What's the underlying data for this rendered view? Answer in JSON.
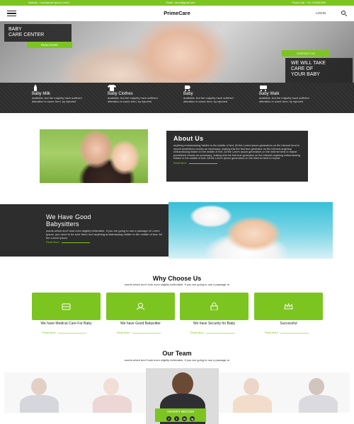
{
  "topbar": {
    "address": "Address : Loremipsum Ipsum Lorem",
    "email": "Email : demo@gmail.com",
    "phone": "Phone Call : +91 1234567890"
  },
  "nav": {
    "brand": "PrimeCare",
    "login": "LOGIN"
  },
  "hero": {
    "title_line1": "BABY",
    "title_line2": "CARE CENTER",
    "read_more": "READ MORE",
    "contact_us": "CONTACT US",
    "care_line1": "WE WILL TAKE",
    "care_line2": "CARE OF",
    "care_line3": "YOUR BABY"
  },
  "features": [
    {
      "title": "Baby Milk",
      "desc": "available, but the majority have suffered alteration in some form, by injected",
      "icon": "bottle-icon"
    },
    {
      "title": "Baby Clothes",
      "desc": "available, but the majority have suffered alteration in some form, by injected",
      "icon": "clothes-icon"
    },
    {
      "title": "Baby",
      "desc": "available, but the majority have suffered alteration in some form, by injected",
      "icon": "stroller-icon"
    },
    {
      "title": "Baby Walk",
      "desc": "available, but the majority have suffered alteration in some form, by injected",
      "icon": "walker-icon"
    }
  ],
  "about": {
    "title": "About Us",
    "text": "anything embarrassing hidden in the middle of text. All the Lorem Ipsum generators on the Internet tend to repeat predefined chunks as necessary, making this the first true generator on the Internet.anything embarrassing hidden in the middle of text. All the Lorem Ipsum generators on the Internet tend to repeat predefined chunks as necessary, making this the first true generator on the Internet.anything embarrassing hidden in the middle of text. All the Lorem Ipsum generators on the Internet tend to repeat",
    "read_more": "Read More"
  },
  "sitters": {
    "title_line1": "We Have Good",
    "title_line2": "Babysitters",
    "text": "words which don't look even slightly believable. If you are going to use a passage of Lorem Ipsum, you need to be sure there isn't anything embarrassing hidden in the middle of text. All the Lorem Ipsum",
    "read_more": "Read More"
  },
  "why": {
    "title": "Why Choose Us",
    "subtitle": "words which don't look even slightly believable. If you are going to use a passage m",
    "read_more": "Read More",
    "cards": [
      {
        "label": "We have Medical Care For Baby",
        "icon": "bed-icon"
      },
      {
        "label": "We have Good Babysitter",
        "icon": "baby-icon"
      },
      {
        "label": "We have Security for Baby",
        "icon": "lock-icon"
      },
      {
        "label": "Successful",
        "icon": "crown-icon"
      }
    ]
  },
  "team": {
    "title": "Our Team",
    "subtitle": "words which don't look even slightly believable. If you are going to use a passage m",
    "member_name": "HENRRY BEIGOM",
    "social": [
      "f",
      "t",
      "in",
      "ig"
    ]
  },
  "colors": {
    "accent": "#7cc520",
    "dark": "#2d2d2d"
  }
}
